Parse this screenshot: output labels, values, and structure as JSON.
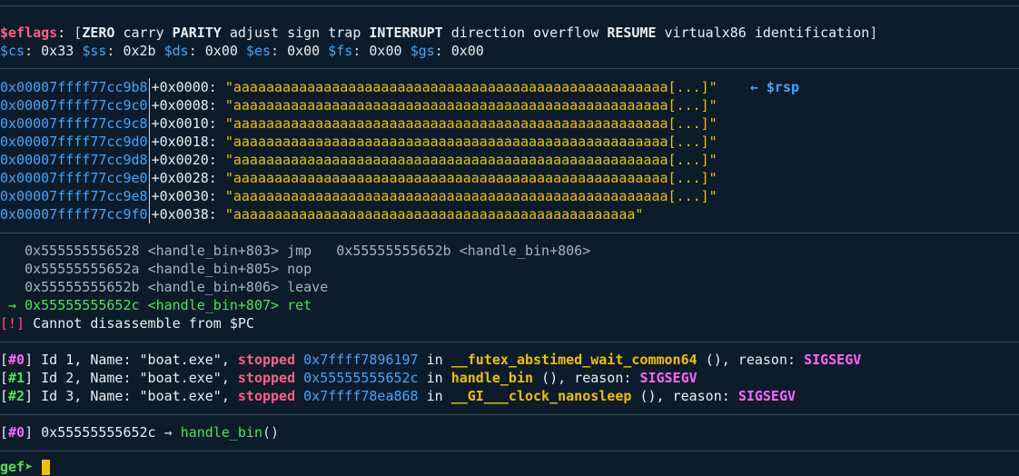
{
  "regs": {
    "eflags_name": "$eflags",
    "flags_open": "[",
    "flags_close": "]",
    "flags": [
      {
        "text": "ZERO",
        "on": true
      },
      {
        "text": "carry",
        "on": false
      },
      {
        "text": "PARITY",
        "on": true
      },
      {
        "text": "adjust",
        "on": false
      },
      {
        "text": "sign",
        "on": false
      },
      {
        "text": "trap",
        "on": false
      },
      {
        "text": "INTERRUPT",
        "on": true
      },
      {
        "text": "direction",
        "on": false
      },
      {
        "text": "overflow",
        "on": false
      },
      {
        "text": "RESUME",
        "on": true
      },
      {
        "text": "virtualx86",
        "on": false
      },
      {
        "text": "identification",
        "on": false
      }
    ],
    "segments": [
      {
        "name": "$cs",
        "value": "0x33"
      },
      {
        "name": "$ss",
        "value": "0x2b"
      },
      {
        "name": "$ds",
        "value": "0x00"
      },
      {
        "name": "$es",
        "value": "0x00"
      },
      {
        "name": "$fs",
        "value": "0x00"
      },
      {
        "name": "$gs",
        "value": "0x00"
      }
    ]
  },
  "stack": {
    "rows": [
      {
        "addr": "0x00007ffff77cc9b8",
        "offset": "+0x0000:",
        "value": "\"aaaaaaaaaaaaaaaaaaaaaaaaaaaaaaaaaaaaaaaaaaaaaaaaaaaaa[...]\"",
        "tag": "← $rsp"
      },
      {
        "addr": "0x00007ffff77cc9c0",
        "offset": "+0x0008:",
        "value": "\"aaaaaaaaaaaaaaaaaaaaaaaaaaaaaaaaaaaaaaaaaaaaaaaaaaaaa[...]\"",
        "tag": ""
      },
      {
        "addr": "0x00007ffff77cc9c8",
        "offset": "+0x0010:",
        "value": "\"aaaaaaaaaaaaaaaaaaaaaaaaaaaaaaaaaaaaaaaaaaaaaaaaaaaaa[...]\"",
        "tag": ""
      },
      {
        "addr": "0x00007ffff77cc9d0",
        "offset": "+0x0018:",
        "value": "\"aaaaaaaaaaaaaaaaaaaaaaaaaaaaaaaaaaaaaaaaaaaaaaaaaaaaa[...]\"",
        "tag": ""
      },
      {
        "addr": "0x00007ffff77cc9d8",
        "offset": "+0x0020:",
        "value": "\"aaaaaaaaaaaaaaaaaaaaaaaaaaaaaaaaaaaaaaaaaaaaaaaaaaaaa[...]\"",
        "tag": ""
      },
      {
        "addr": "0x00007ffff77cc9e0",
        "offset": "+0x0028:",
        "value": "\"aaaaaaaaaaaaaaaaaaaaaaaaaaaaaaaaaaaaaaaaaaaaaaaaaaaaa[...]\"",
        "tag": ""
      },
      {
        "addr": "0x00007ffff77cc9e8",
        "offset": "+0x0030:",
        "value": "\"aaaaaaaaaaaaaaaaaaaaaaaaaaaaaaaaaaaaaaaaaaaaaaaaaaaaa[...]\"",
        "tag": ""
      },
      {
        "addr": "0x00007ffff77cc9f0",
        "offset": "+0x0038:",
        "value": "\"aaaaaaaaaaaaaaaaaaaaaaaaaaaaaaaaaaaaaaaaaaaaaaaaa\"",
        "tag": ""
      }
    ]
  },
  "code": {
    "rows": [
      {
        "prefix": "   ",
        "addr": "0x555555556528",
        "sym": "<handle_bin+803>",
        "mnemonic": "jmp",
        "operand": "   0x55555555652b <handle_bin+806>",
        "current": false
      },
      {
        "prefix": "   ",
        "addr": "0x55555555652a",
        "sym": "<handle_bin+805>",
        "mnemonic": "nop",
        "operand": "",
        "current": false
      },
      {
        "prefix": "   ",
        "addr": "0x55555555652b",
        "sym": "<handle_bin+806>",
        "mnemonic": "leave",
        "operand": "",
        "current": false
      },
      {
        "prefix": " → ",
        "addr": "0x55555555652c",
        "sym": "<handle_bin+807>",
        "mnemonic": "ret",
        "operand": "",
        "current": true
      }
    ],
    "error_tag": "[!]",
    "error_text": "Cannot disassemble from $PC"
  },
  "threads": {
    "rows": [
      {
        "idx": "#0",
        "pre": "Id 1, Name: \"boat.exe\", ",
        "state": "stopped",
        "addr": "0x7ffff7896197",
        "in": "in",
        "func": "__futex_abstimed_wait_common64",
        "post": "(), reason: ",
        "reason": "SIGSEGV"
      },
      {
        "idx": "#1",
        "pre": "Id 2, Name: \"boat.exe\", ",
        "state": "stopped",
        "addr": "0x55555555652c",
        "in": "in",
        "func": "handle_bin",
        "post": "(), reason: ",
        "reason": "SIGSEGV"
      },
      {
        "idx": "#2",
        "pre": "Id 3, Name: \"boat.exe\", ",
        "state": "stopped",
        "addr": "0x7ffff78ea868",
        "in": "in",
        "func": "__GI___clock_nanosleep",
        "post": "(), reason: ",
        "reason": "SIGSEGV"
      }
    ]
  },
  "trace": {
    "idx": "#0",
    "addr": "0x55555555652c",
    "arrow": "→",
    "func": "handle_bin",
    "args": "()"
  },
  "prompt": {
    "text": "gef➤"
  },
  "colors": {
    "background": "#0c1c2b",
    "register": "#ff5f87",
    "address": "#3fa7ff",
    "string": "#f0c000",
    "current": "#4ee34e",
    "signal": "#ff66ff"
  }
}
